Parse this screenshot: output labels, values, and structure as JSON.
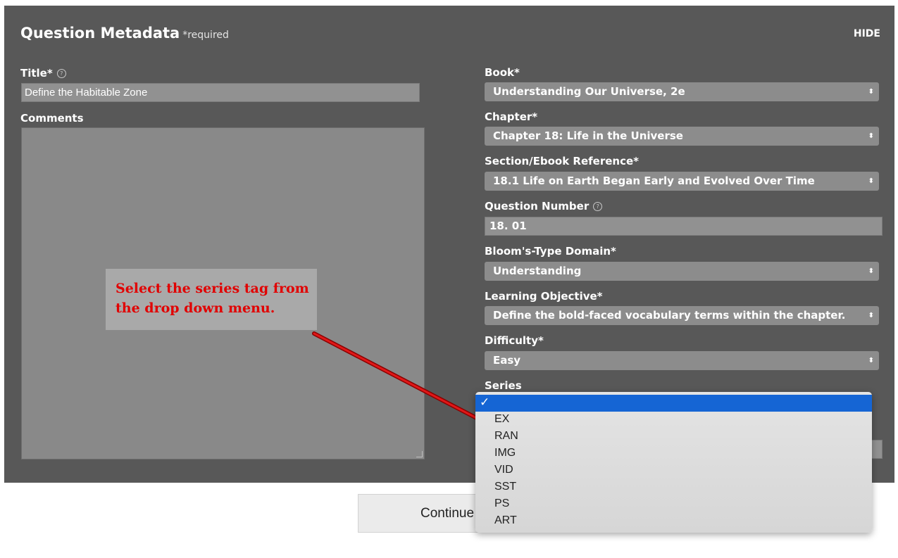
{
  "header": {
    "title": "Question Metadata",
    "required_note": "*required",
    "hide_label": "HIDE"
  },
  "fields": {
    "title_label": "Title*",
    "title_value": "Define the Habitable Zone",
    "comments_label": "Comments",
    "book_label": "Book*",
    "book_value": "Understanding Our Universe, 2e",
    "chapter_label": "Chapter*",
    "chapter_value": "Chapter 18: Life in the Universe",
    "section_label": "Section/Ebook Reference*",
    "section_value": "18.1 Life on Earth Began Early and Evolved Over Time",
    "qnum_label": "Question Number",
    "qnum_value": "18. 01",
    "bloom_label": "Bloom's-Type Domain*",
    "bloom_value": "Understanding",
    "objective_label": "Learning Objective*",
    "objective_value": "Define the bold-faced vocabulary terms within the chapter.",
    "difficulty_label": "Difficulty*",
    "difficulty_value": "Easy",
    "series_label": "Series"
  },
  "series_dropdown": {
    "selected_mark": "✓",
    "options": [
      "EX",
      "RAN",
      "IMG",
      "VID",
      "SST",
      "PS",
      "ART"
    ]
  },
  "callout": {
    "text": "Select the series tag from\nthe drop down menu."
  },
  "footer": {
    "continue_label": "Continue"
  },
  "icons": {
    "help": "help-circle-icon",
    "select_arrows": "select-arrows-icon",
    "check": "checkmark-icon"
  },
  "colors": {
    "panel": "#585858",
    "accent": "#1565d4",
    "callout_text": "#e10000",
    "callout_arrow": "#e01818"
  }
}
